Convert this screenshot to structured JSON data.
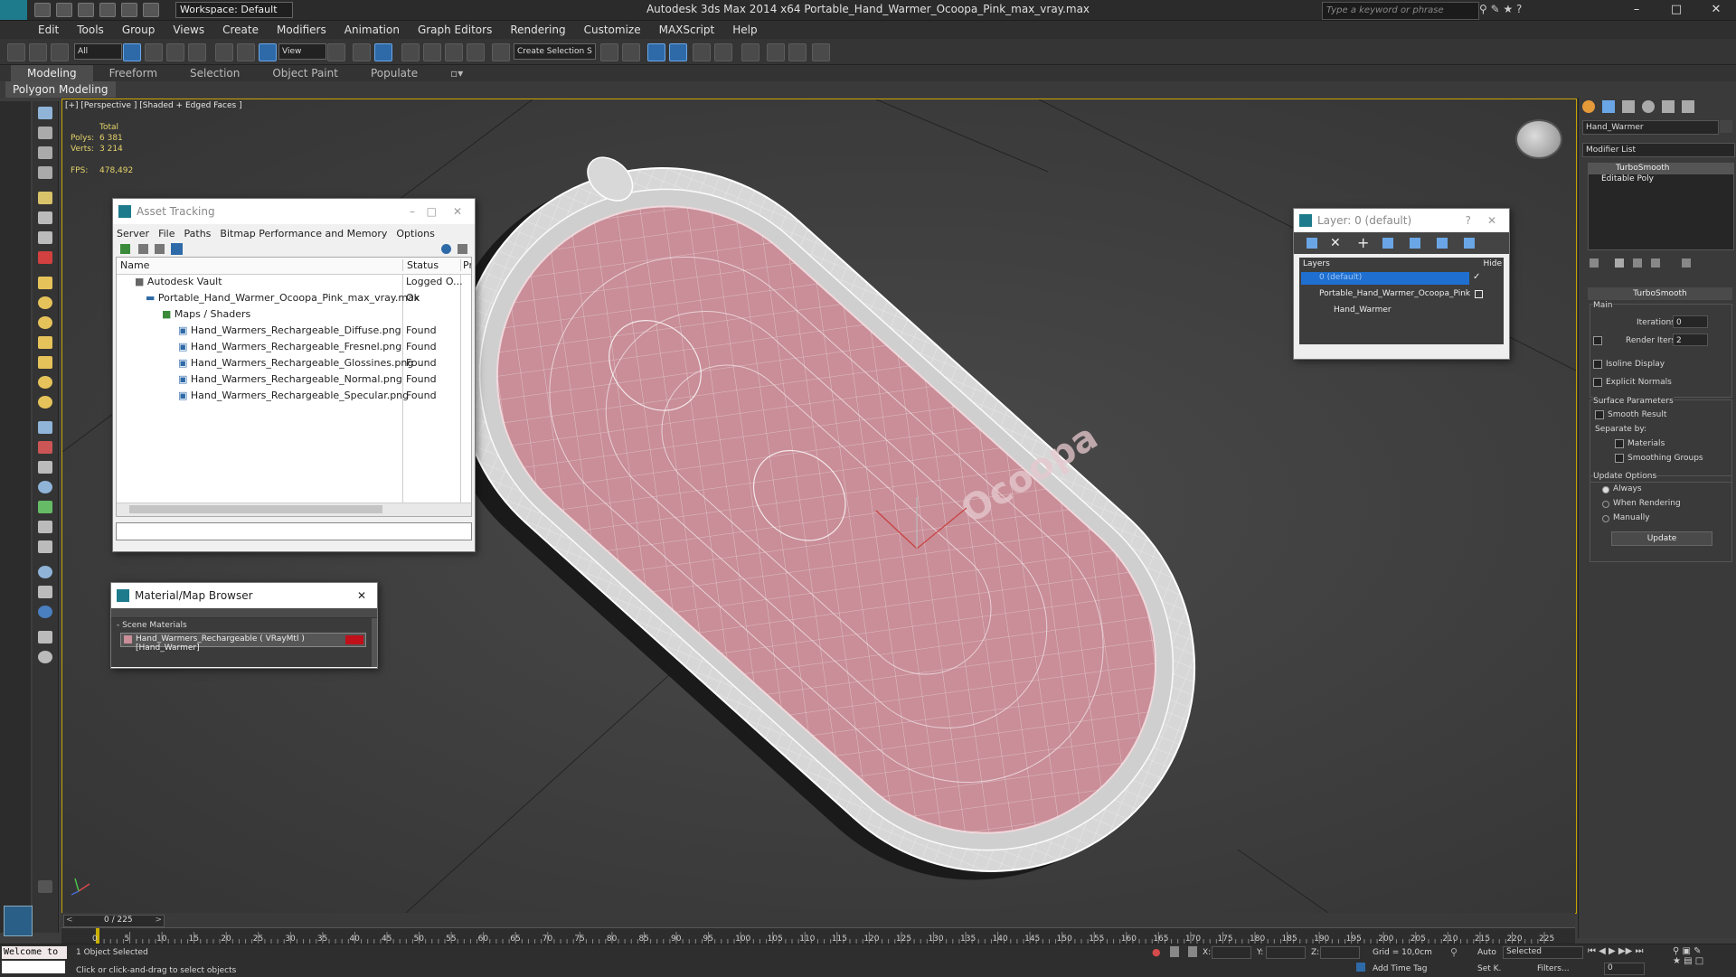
{
  "app": {
    "title": "Autodesk 3ds Max  2014 x64      Portable_Hand_Warmer_Ocoopa_Pink_max_vray.max",
    "workspace": "Workspace: Default",
    "search_placeholder": "Type a keyword or phrase"
  },
  "menu": [
    "Edit",
    "Tools",
    "Group",
    "Views",
    "Create",
    "Modifiers",
    "Animation",
    "Graph Editors",
    "Rendering",
    "Customize",
    "MAXScript",
    "Help"
  ],
  "toolbar": {
    "selection_filter": "All",
    "ref_coord": "View",
    "named_selection": "Create Selection S"
  },
  "ribbon": {
    "tabs": [
      "Modeling",
      "Freeform",
      "Selection",
      "Object Paint",
      "Populate"
    ],
    "active": "Modeling",
    "panel": "Polygon Modeling"
  },
  "viewport": {
    "label": "[+] [Perspective ] [Shaded + Edged Faces ]",
    "stats_header": "Total",
    "polys_label": "Polys:",
    "polys_value": "6 381",
    "verts_label": "Verts:",
    "verts_value": "3 214",
    "fps_label": "FPS:",
    "fps_value": "478,492",
    "watermark": "Ocoopa"
  },
  "asset_tracking": {
    "title": "Asset Tracking",
    "menu": [
      "Server",
      "File",
      "Paths",
      "Bitmap Performance and Memory",
      "Options"
    ],
    "col_name": "Name",
    "col_status": "Status",
    "col_extra": "Pr",
    "rows": [
      {
        "name": "Autodesk Vault",
        "status": "Logged O..."
      },
      {
        "name": "Portable_Hand_Warmer_Ocoopa_Pink_max_vray.max",
        "status": "Ok"
      },
      {
        "name": "Maps / Shaders",
        "status": ""
      },
      {
        "name": "Hand_Warmers_Rechargeable_Diffuse.png",
        "status": "Found"
      },
      {
        "name": "Hand_Warmers_Rechargeable_Fresnel.png",
        "status": "Found"
      },
      {
        "name": "Hand_Warmers_Rechargeable_Glossines.png",
        "status": "Found"
      },
      {
        "name": "Hand_Warmers_Rechargeable_Normal.png",
        "status": "Found"
      },
      {
        "name": "Hand_Warmers_Rechargeable_Specular.png",
        "status": "Found"
      }
    ]
  },
  "material_browser": {
    "title": "Material/Map Browser",
    "group": "- Scene Materials",
    "item": "Hand_Warmers_Rechargeable  ( VRayMtl ) [Hand_Warmer]"
  },
  "layer_dialog": {
    "title": "Layer: 0 (default)",
    "col_layers": "Layers",
    "col_hide": "Hide",
    "rows": [
      "0 (default)",
      "Portable_Hand_Warmer_Ocoopa_Pink",
      "Hand_Warmer"
    ]
  },
  "command_panel": {
    "object_name": "Hand_Warmer",
    "modifier_list": "Modifier List",
    "stack": [
      "TurboSmooth",
      "Editable Poly"
    ],
    "rollout": "TurboSmooth",
    "main": "Main",
    "iterations_label": "Iterations:",
    "iterations_value": "0",
    "render_iters_label": "Render Iters:",
    "render_iters_value": "2",
    "isoline": "Isoline Display",
    "explicit": "Explicit Normals",
    "surface": "Surface Parameters",
    "smooth_result": "Smooth Result",
    "separate_by": "Separate by:",
    "materials": "Materials",
    "smoothing_groups": "Smoothing Groups",
    "update_options": "Update Options",
    "always": "Always",
    "when_rendering": "When Rendering",
    "manually": "Manually",
    "update_btn": "Update"
  },
  "timeline": {
    "frame": "0 / 225",
    "ticks": [
      "0",
      "5",
      "10",
      "15",
      "20",
      "25",
      "30",
      "35",
      "40",
      "45",
      "50",
      "55",
      "60",
      "65",
      "70",
      "75",
      "80",
      "85",
      "90",
      "95",
      "100",
      "105",
      "110",
      "115",
      "120",
      "125",
      "130",
      "135",
      "140",
      "145",
      "150",
      "155",
      "160",
      "165",
      "170",
      "175",
      "180",
      "185",
      "190",
      "195",
      "200",
      "205",
      "210",
      "215",
      "220",
      "225"
    ]
  },
  "status": {
    "maxscript": "Welcome to",
    "selected": "1 Object Selected",
    "prompt": "Click or click-and-drag to select objects",
    "x_label": "X:",
    "y_label": "Y:",
    "z_label": "Z:",
    "grid": "Grid = 10,0cm",
    "add_time_tag": "Add Time Tag",
    "auto": "Auto",
    "set_key": "Set K.",
    "selected_dropdown": "Selected",
    "filters": "Filters...",
    "frame_value": "0"
  }
}
